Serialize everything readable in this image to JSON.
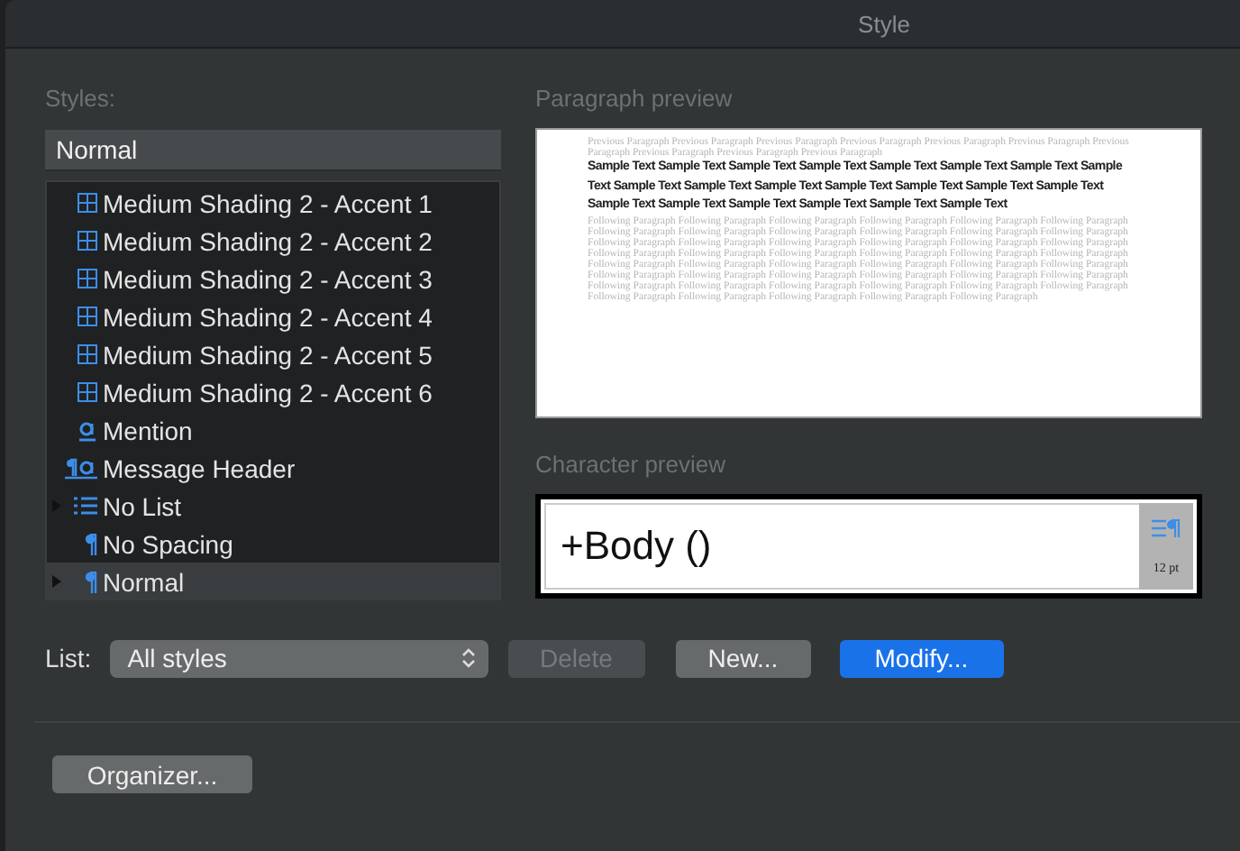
{
  "window": {
    "title": "Style"
  },
  "styles": {
    "label": "Styles:",
    "value": "Normal",
    "items": [
      {
        "label": "Medium Shading 2 - Accent 1",
        "kind": "table",
        "expandable": false,
        "selected": false
      },
      {
        "label": "Medium Shading 2 - Accent 2",
        "kind": "table",
        "expandable": false,
        "selected": false
      },
      {
        "label": "Medium Shading 2 - Accent 3",
        "kind": "table",
        "expandable": false,
        "selected": false
      },
      {
        "label": "Medium Shading 2 - Accent 4",
        "kind": "table",
        "expandable": false,
        "selected": false
      },
      {
        "label": "Medium Shading 2 - Accent 5",
        "kind": "table",
        "expandable": false,
        "selected": false
      },
      {
        "label": "Medium Shading 2 - Accent 6",
        "kind": "table",
        "expandable": false,
        "selected": false
      },
      {
        "label": "Mention",
        "kind": "character",
        "expandable": false,
        "selected": false
      },
      {
        "label": "Message Header",
        "kind": "linked",
        "expandable": false,
        "selected": false
      },
      {
        "label": "No List",
        "kind": "list",
        "expandable": true,
        "selected": false
      },
      {
        "label": "No Spacing",
        "kind": "paragraph",
        "expandable": false,
        "selected": false
      },
      {
        "label": "Normal",
        "kind": "paragraph",
        "expandable": true,
        "selected": true
      }
    ]
  },
  "paragraph_preview": {
    "label": "Paragraph preview",
    "previous": "Previous Paragraph Previous Paragraph Previous Paragraph Previous Paragraph Previous Paragraph Previous Paragraph Previous Paragraph Previous Paragraph Previous Paragraph Previous Paragraph",
    "sample": "Sample Text Sample Text Sample Text Sample Text Sample Text Sample Text Sample Text Sample Text Sample Text Sample Text Sample Text Sample Text Sample Text Sample Text Sample Text Sample Text Sample Text Sample Text Sample Text Sample Text Sample Text",
    "following": "Following Paragraph Following Paragraph Following Paragraph Following Paragraph Following Paragraph Following Paragraph Following Paragraph Following Paragraph Following Paragraph Following Paragraph Following Paragraph Following Paragraph Following Paragraph Following Paragraph Following Paragraph Following Paragraph Following Paragraph Following Paragraph Following Paragraph Following Paragraph Following Paragraph Following Paragraph Following Paragraph Following Paragraph Following Paragraph Following Paragraph Following Paragraph Following Paragraph Following Paragraph Following Paragraph Following Paragraph Following Paragraph Following Paragraph Following Paragraph Following Paragraph Following Paragraph Following Paragraph Following Paragraph Following Paragraph Following Paragraph Following Paragraph Following Paragraph Following Paragraph Following Paragraph Following Paragraph Following Paragraph Following Paragraph"
  },
  "character_preview": {
    "label": "Character preview",
    "text": "+Body ()",
    "size": "12 pt"
  },
  "list": {
    "label": "List:",
    "value": "All styles"
  },
  "buttons": [
    {
      "label": "Delete",
      "disabled": true,
      "default": false
    },
    {
      "label": "New...",
      "disabled": false,
      "default": false
    },
    {
      "label": "Modify...",
      "disabled": false,
      "default": true
    }
  ],
  "organizer": {
    "label": "Organizer..."
  }
}
